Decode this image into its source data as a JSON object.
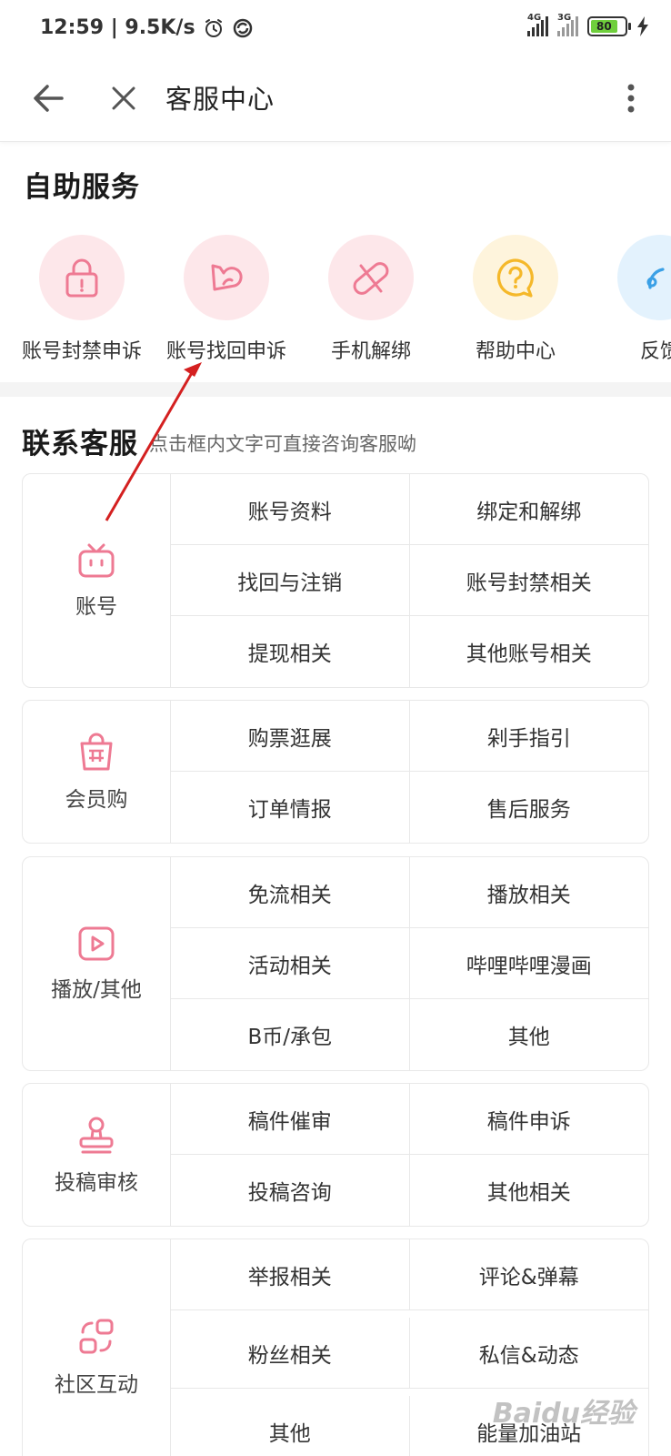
{
  "status_bar": {
    "time_speed": "12:59 | 9.5K/s",
    "network_1": "4G",
    "network_2": "3G",
    "battery": "80"
  },
  "title_bar": {
    "title": "客服中心"
  },
  "self_service": {
    "title": "自助服务",
    "items": [
      {
        "label": "账号封禁申诉",
        "icon": "lock-icon",
        "bg": "#fde7ea",
        "color": "#ee7a93"
      },
      {
        "label": "账号找回申诉",
        "icon": "return-arrow-icon",
        "bg": "#fde7ea",
        "color": "#ee7a93"
      },
      {
        "label": "手机解绑",
        "icon": "unlink-icon",
        "bg": "#fde7ea",
        "color": "#ee7a93"
      },
      {
        "label": "帮助中心",
        "icon": "help-bubble-icon",
        "bg": "#fef4dc",
        "color": "#f5b82a"
      },
      {
        "label": "反馈",
        "icon": "feedback-icon",
        "bg": "#e3f2fd",
        "color": "#3aa0e6"
      }
    ]
  },
  "contact": {
    "title": "联系客服",
    "subtitle": "点击框内文字可直接咨询客服呦",
    "groups": [
      {
        "category": "账号",
        "icon": "tv-icon",
        "items": [
          "账号资料",
          "绑定和解绑",
          "找回与注销",
          "账号封禁相关",
          "提现相关",
          "其他账号相关"
        ]
      },
      {
        "category": "会员购",
        "icon": "shopping-bag-icon",
        "items": [
          "购票逛展",
          "剁手指引",
          "订单情报",
          "售后服务"
        ]
      },
      {
        "category": "播放/其他",
        "icon": "play-icon",
        "items": [
          "免流相关",
          "播放相关",
          "活动相关",
          "哔哩哔哩漫画",
          "B币/承包",
          "其他"
        ]
      },
      {
        "category": "投稿审核",
        "icon": "stamp-icon",
        "items": [
          "稿件催审",
          "稿件申诉",
          "投稿咨询",
          "其他相关"
        ]
      },
      {
        "category": "社区互动",
        "icon": "community-icon",
        "items": [
          "举报相关",
          "评论&弹幕",
          "粉丝相关",
          "私信&动态",
          "其他",
          "能量加油站"
        ]
      }
    ]
  },
  "watermark": "Baidu经验",
  "colors": {
    "accent_pink": "#ee7a93",
    "annotation_red": "#d42020"
  }
}
